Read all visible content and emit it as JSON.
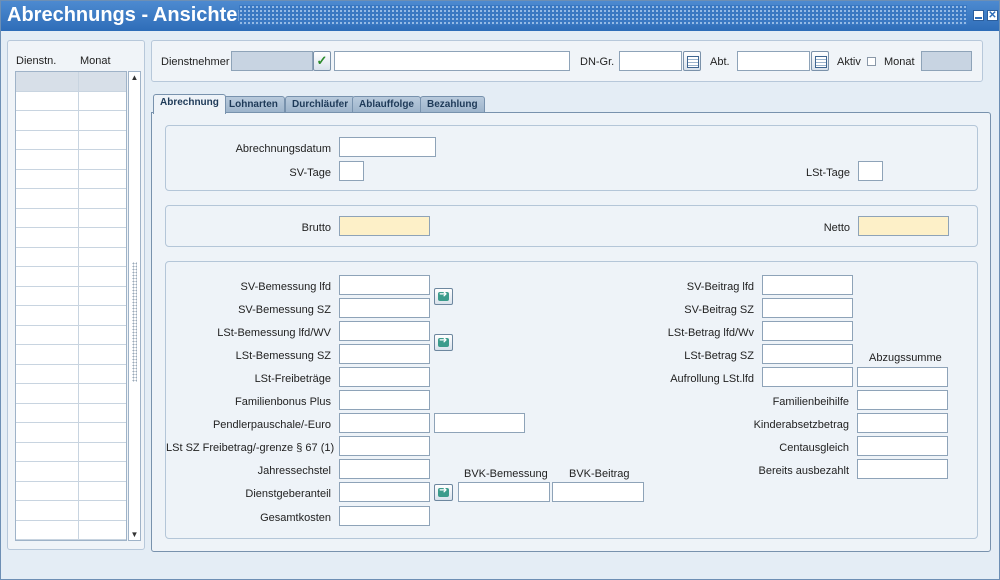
{
  "window": {
    "title": "Abrechnungs - Ansichten"
  },
  "left_list": {
    "columns": [
      "Dienstn.",
      "Monat"
    ],
    "row_count": 24
  },
  "header": {
    "dienstnehmer_label": "Dienstnehmer",
    "dn_gr_label": "DN-Gr.",
    "abt_label": "Abt.",
    "aktiv_label": "Aktiv",
    "monat_label": "Monat"
  },
  "tabs": [
    {
      "label": "Abrechnung",
      "active": true
    },
    {
      "label": "Lohnarten"
    },
    {
      "label": "Durchläufer"
    },
    {
      "label": "Ablauffolge"
    },
    {
      "label": "Bezahlung"
    }
  ],
  "section1": {
    "abrechnungsdatum": "Abrechnungsdatum",
    "sv_tage": "SV-Tage",
    "lst_tage": "LSt-Tage"
  },
  "section2": {
    "brutto": "Brutto",
    "netto": "Netto"
  },
  "section3": {
    "left": {
      "sv_bem_lfd": "SV-Bemessung lfd",
      "sv_bem_sz": "SV-Bemessung SZ",
      "lst_bem_lfd": "LSt-Bemessung lfd/WV",
      "lst_bem_sz": "LSt-Bemessung SZ",
      "lst_freibetraege": "LSt-Freibeträge",
      "familienbonus": "Familienbonus Plus",
      "pendler": "Pendlerpauschale/-Euro",
      "lst_sz_frei": "LSt SZ Freibetrag/-grenze § 67 (1)",
      "jahressechstel": "Jahressechstel",
      "dienstgeberanteil": "Dienstgeberanteil",
      "gesamtkosten": "Gesamtkosten"
    },
    "mid": {
      "bvk_bemessung": "BVK-Bemessung",
      "bvk_beitrag": "BVK-Beitrag"
    },
    "right": {
      "sv_beitrag_lfd": "SV-Beitrag lfd",
      "sv_beitrag_sz": "SV-Beitrag SZ",
      "lst_beitrag_lfd": "LSt-Betrag lfd/Wv",
      "lst_beitrag_sz": "LSt-Betrag SZ",
      "abzugssumme": "Abzugssumme",
      "aufrollung": "Aufrollung LSt.lfd",
      "familienbeihilfe": "Familienbeihilfe",
      "kinderabsetz": "Kinderabsetzbetrag",
      "centausgleich": "Centausgleich",
      "bereits": "Bereits ausbezahlt"
    }
  }
}
